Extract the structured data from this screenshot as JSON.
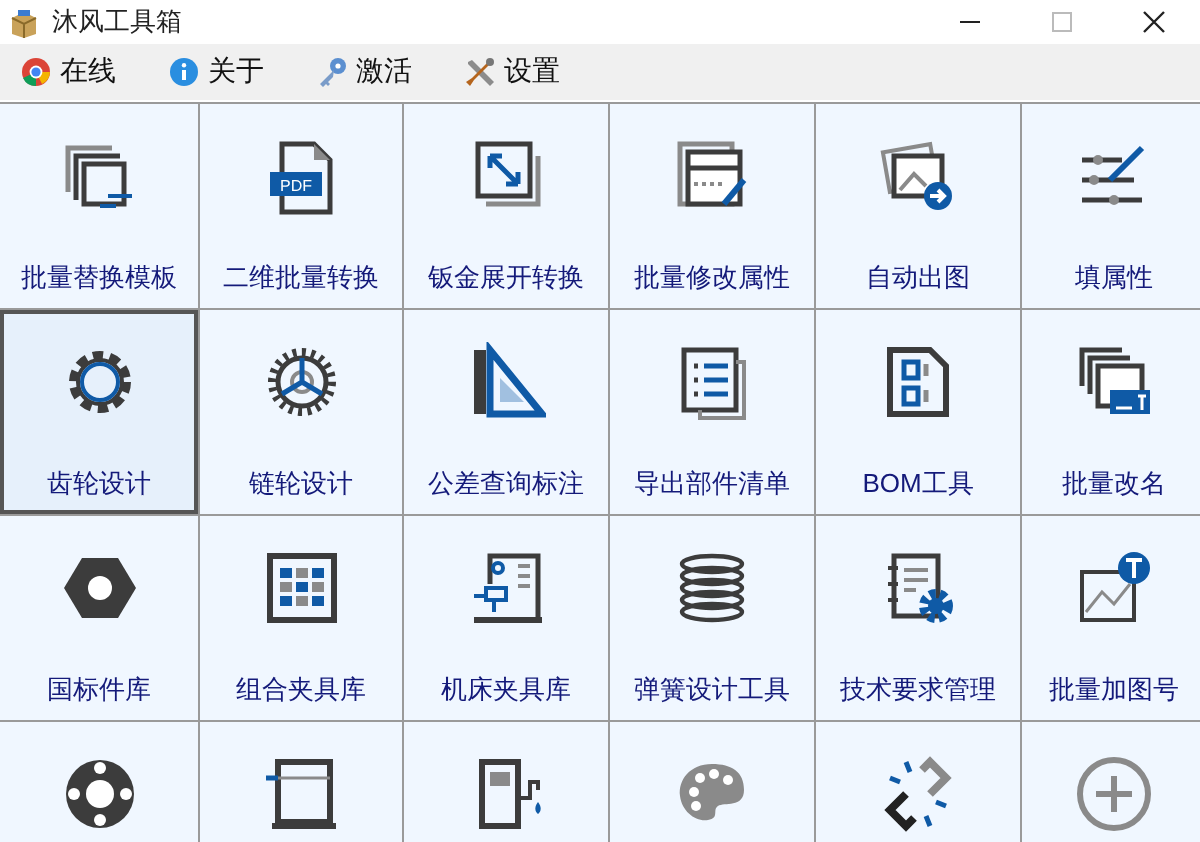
{
  "window": {
    "title": "沐风工具箱"
  },
  "menu": [
    {
      "label": "在线",
      "kind": "browser"
    },
    {
      "label": "关于",
      "kind": "info"
    },
    {
      "label": "激活",
      "kind": "key"
    },
    {
      "label": "设置",
      "kind": "tools"
    }
  ],
  "tiles": [
    {
      "label": "批量替换模板",
      "kind": "stack-swap",
      "selected": false
    },
    {
      "label": "二维批量转换",
      "kind": "pdf",
      "badge": "PDF",
      "selected": false
    },
    {
      "label": "钣金展开转换",
      "kind": "expand",
      "selected": false
    },
    {
      "label": "批量修改属性",
      "kind": "form-edit",
      "selected": false
    },
    {
      "label": "自动出图",
      "kind": "images-arrow",
      "selected": false
    },
    {
      "label": "填属性",
      "kind": "sliders-pen",
      "selected": false
    },
    {
      "label": "齿轮设计",
      "kind": "gear",
      "selected": true
    },
    {
      "label": "链轮设计",
      "kind": "sprocket",
      "selected": false
    },
    {
      "label": "公差查询标注",
      "kind": "set-square",
      "selected": false
    },
    {
      "label": "导出部件清单",
      "kind": "list",
      "selected": false
    },
    {
      "label": "BOM工具",
      "kind": "bom",
      "selected": false
    },
    {
      "label": "批量改名",
      "kind": "stack-text",
      "selected": false
    },
    {
      "label": "国标件库",
      "kind": "nut",
      "selected": false
    },
    {
      "label": "组合夹具库",
      "kind": "grid",
      "selected": false
    },
    {
      "label": "机床夹具库",
      "kind": "machine",
      "selected": false
    },
    {
      "label": "弹簧设计工具",
      "kind": "spring",
      "selected": false
    },
    {
      "label": "技术要求管理",
      "kind": "doc-gear",
      "selected": false
    },
    {
      "label": "批量加图号",
      "kind": "image-badge",
      "selected": false
    },
    {
      "kind": "flange",
      "selected": false
    },
    {
      "kind": "cylinder",
      "selected": false
    },
    {
      "kind": "pump",
      "selected": false
    },
    {
      "kind": "palette",
      "selected": false
    },
    {
      "kind": "broken-link",
      "selected": false
    },
    {
      "kind": "plus-circle",
      "selected": false
    }
  ]
}
